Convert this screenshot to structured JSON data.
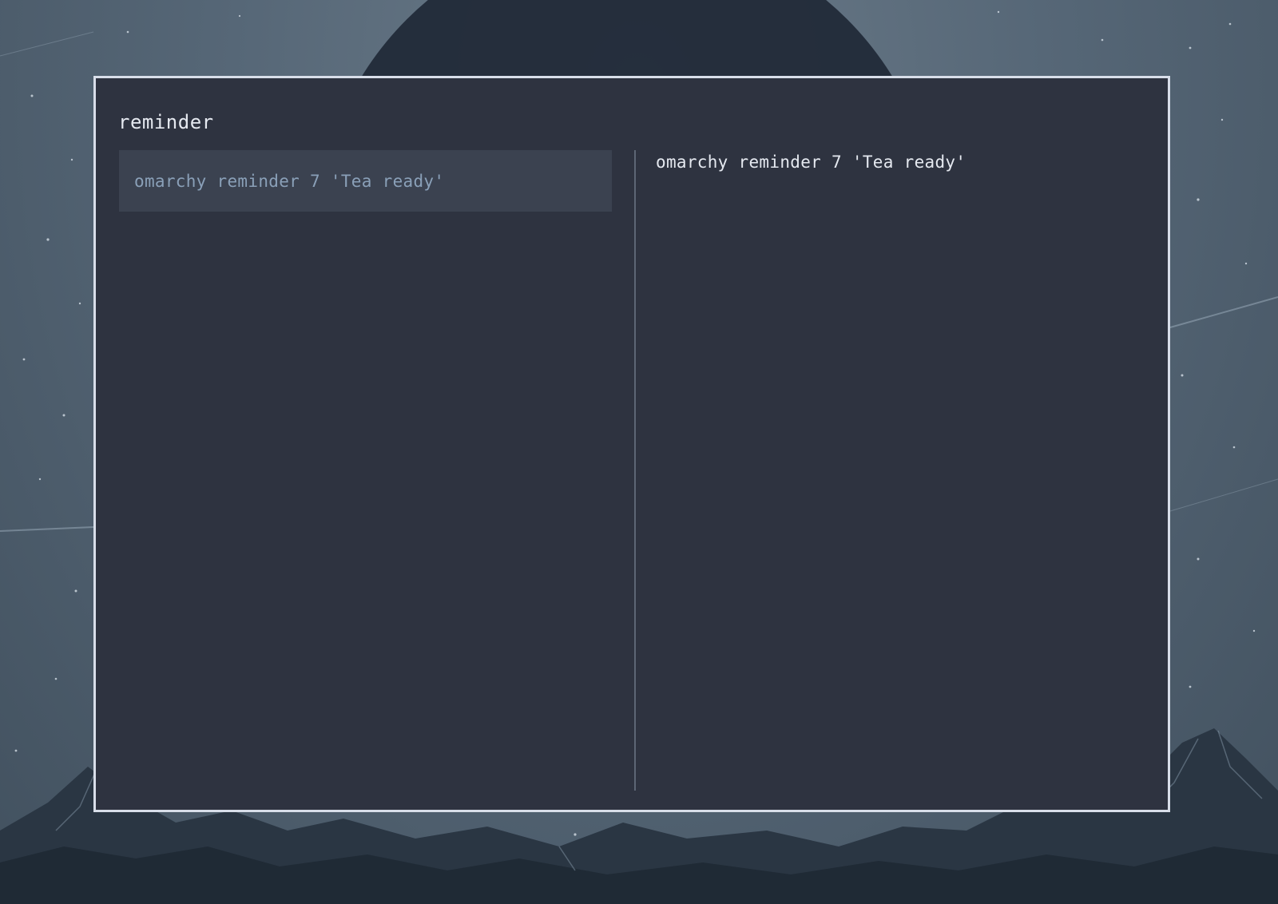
{
  "search": {
    "query": "reminder"
  },
  "results": [
    {
      "label": "omarchy reminder 7 'Tea ready'"
    }
  ],
  "preview": {
    "text": "omarchy reminder 7 'Tea ready'"
  },
  "colors": {
    "window_bg": "#2e3340",
    "window_border": "#d8dee9",
    "selected_bg": "#3b4250",
    "selected_text": "#8aa0b8",
    "text": "#e5e9f0",
    "divider": "#5d6675"
  }
}
